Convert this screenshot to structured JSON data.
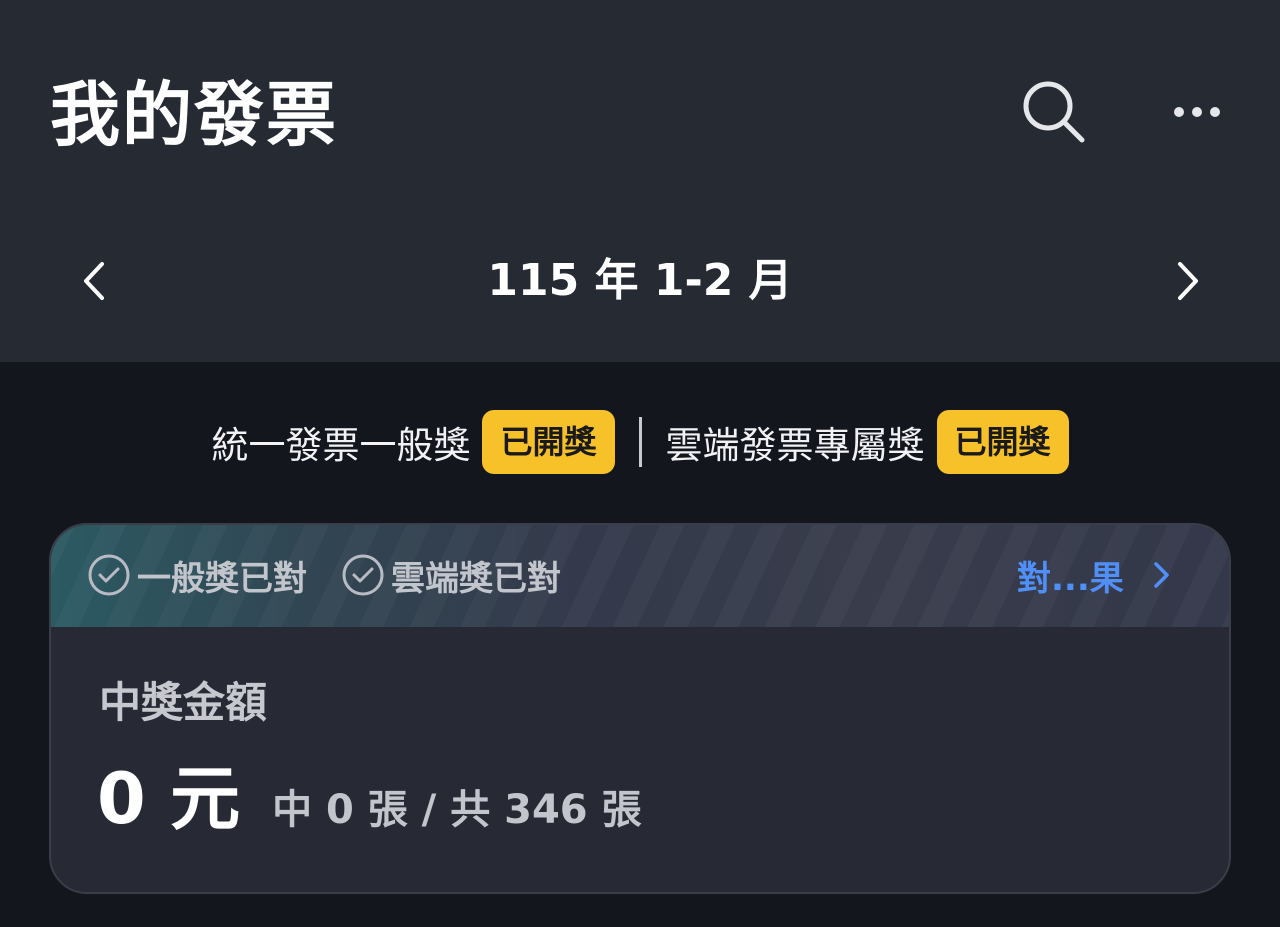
{
  "header": {
    "title": "我的發票",
    "search_icon": "search-icon",
    "more_icon": "more-horizontal-icon"
  },
  "period": {
    "label": "115 年 1-2 月",
    "prev_icon": "chevron-left-icon",
    "next_icon": "chevron-right-icon"
  },
  "draw_status": {
    "general_label": "統一發票一般獎",
    "general_badge": "已開獎",
    "cloud_label": "雲端發票專屬獎",
    "cloud_badge": "已開獎"
  },
  "prize_card": {
    "checks": [
      {
        "label": "一般獎已對",
        "icon": "check-circle-icon"
      },
      {
        "label": "雲端獎已對",
        "icon": "check-circle-icon"
      }
    ],
    "result_link": "對...果",
    "amount_label": "中獎金額",
    "amount": "0 元",
    "won_count": 0,
    "total_count": 346,
    "count_summary": "中 0 張 / 共 346 張"
  },
  "colors": {
    "header_bg": "#262a33",
    "page_bg": "#14161e",
    "badge_bg": "#f7c129",
    "link_blue": "#4f8ff7"
  }
}
